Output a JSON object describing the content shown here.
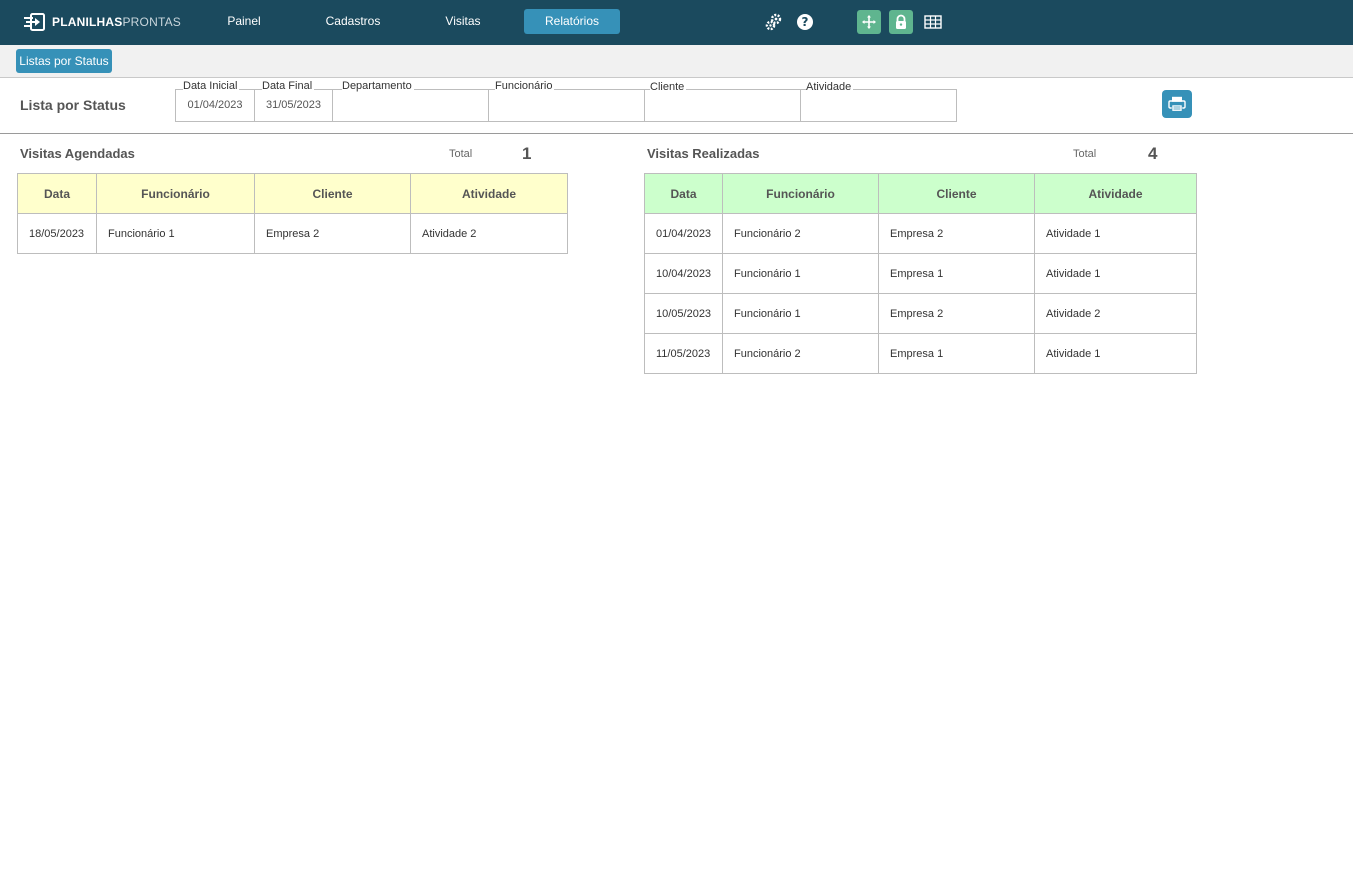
{
  "app": {
    "logo_bold": "PLANILHAS",
    "logo_light": "PRONTAS"
  },
  "nav": {
    "items": [
      {
        "label": "Painel"
      },
      {
        "label": "Cadastros"
      },
      {
        "label": "Visitas"
      },
      {
        "label": "Relatórios"
      }
    ],
    "active": "Relatórios"
  },
  "toolbar_icons": [
    "gears-icon",
    "help-icon",
    "move-icon",
    "lock-icon",
    "grid-icon"
  ],
  "subbar": {
    "button_label": "Listas por Status"
  },
  "page": {
    "title": "Lista por Status"
  },
  "filters": {
    "data_inicial": {
      "label": "Data Inicial",
      "value": "01/04/2023"
    },
    "data_final": {
      "label": "Data Final",
      "value": "31/05/2023"
    },
    "departamento": {
      "label": "Departamento",
      "value": ""
    },
    "funcionario": {
      "label": "Funcionário",
      "value": ""
    },
    "cliente": {
      "label": "Cliente",
      "value": ""
    },
    "atividade": {
      "label": "Atividade",
      "value": ""
    }
  },
  "agendadas": {
    "title": "Visitas Agendadas",
    "total_label": "Total",
    "total_value": "1",
    "columns": [
      "Data",
      "Funcionário",
      "Cliente",
      "Atividade"
    ],
    "rows": [
      [
        "18/05/2023",
        "Funcionário 1",
        "Empresa 2",
        "Atividade 2"
      ]
    ]
  },
  "realizadas": {
    "title": "Visitas Realizadas",
    "total_label": "Total",
    "total_value": "4",
    "columns": [
      "Data",
      "Funcionário",
      "Cliente",
      "Atividade"
    ],
    "rows": [
      [
        "01/04/2023",
        "Funcionário 2",
        "Empresa 2",
        "Atividade 1"
      ],
      [
        "10/04/2023",
        "Funcionário 1",
        "Empresa 1",
        "Atividade 1"
      ],
      [
        "10/05/2023",
        "Funcionário 1",
        "Empresa 2",
        "Atividade 2"
      ],
      [
        "11/05/2023",
        "Funcionário 2",
        "Empresa 1",
        "Atividade 1"
      ]
    ]
  },
  "colors": {
    "topbar": "#1b4a5e",
    "accent": "#3691b8",
    "toggle_green": "#5fb58f",
    "header_yellow": "#ffffcc",
    "header_green": "#ccffcc"
  }
}
